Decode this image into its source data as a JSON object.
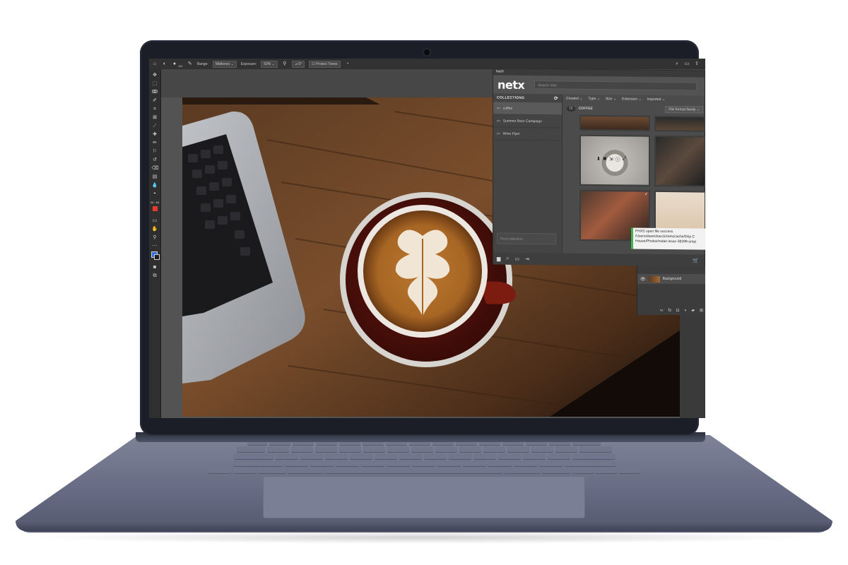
{
  "options_bar": {
    "brush_size": "161",
    "range_label": "Range:",
    "range_value": "Midtones",
    "exposure_label": "Exposure:",
    "exposure_value": "50%",
    "angle_value": "0°",
    "protect_tones": "Protect Tones"
  },
  "toolbar": {
    "time_readout": "24 : 54",
    "foreground_color": "#e8392b",
    "swatch_fg": "#2f6fe0",
    "swatch_bg": "#1b1b1b"
  },
  "netx": {
    "tab_title": "NetX",
    "logo": "netx",
    "search_placeholder": "Search netx",
    "collections_header": "COLLECTIONS",
    "collections": [
      {
        "label": "coffee",
        "active": true
      },
      {
        "label": "Summer Beer Campaign",
        "active": false
      },
      {
        "label": "Wine Flyer",
        "active": false
      }
    ],
    "find_placeholder": "Find collection",
    "filters": [
      "Created",
      "Type",
      "Size",
      "Extension",
      "Imported"
    ],
    "breadcrumb_count": "15",
    "breadcrumb_label": "COFFEE",
    "sort_label": "File format family",
    "toast_lines": [
      "PHXS open file success",
      "/Users/dsavickas11/netx/cache/Drip C",
      "House/Photos/nolan-issac-38299-unsp"
    ]
  },
  "layers": {
    "layer_name": "Background"
  },
  "colors": {
    "accent_green": "#3fb451",
    "panel_bg": "#4b4b4b",
    "laptop_body": "#6b7087"
  }
}
